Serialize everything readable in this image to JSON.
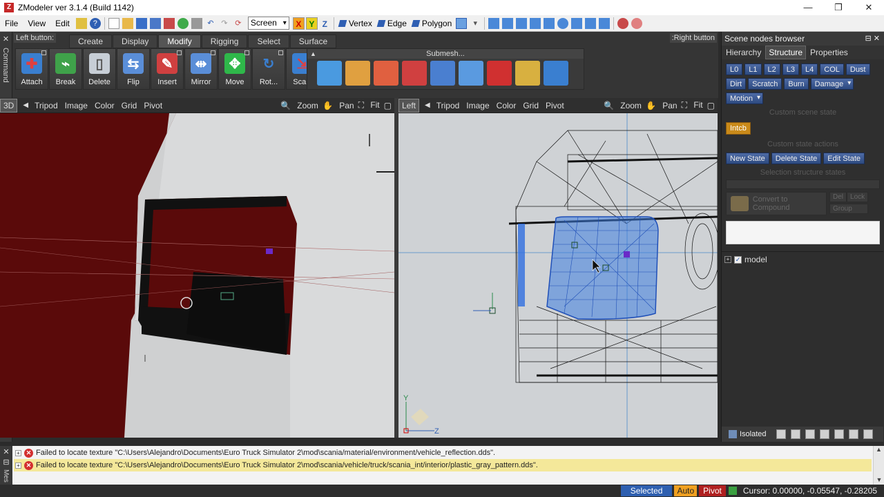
{
  "window": {
    "title": "ZModeler ver 3.1.4 (Build 1142)",
    "app_icon_letter": "Z",
    "controls": {
      "minimize": "—",
      "restore": "❐",
      "close": "✕"
    }
  },
  "menu": {
    "items": [
      "File",
      "View",
      "Edit"
    ],
    "screen_select": "Screen",
    "axes": [
      "X",
      "Y",
      "Z"
    ],
    "modes": [
      "Vertex",
      "Edge",
      "Polygon"
    ]
  },
  "command_strip": {
    "label": "Command",
    "close": "✕"
  },
  "command_panel": {
    "left_button_label": "Left button:",
    "right_button_label": ":Right button",
    "tabs": [
      "Create",
      "Display",
      "Modify",
      "Rigging",
      "Select",
      "Surface"
    ],
    "active_tab": "Modify",
    "tools": [
      {
        "label": "Attach",
        "icon": "attach-icon",
        "color": "#3a7fd0"
      },
      {
        "label": "Break",
        "icon": "break-icon",
        "color": "#3fa24a"
      },
      {
        "label": "Delete",
        "icon": "trash-icon",
        "color": "#c7ced6"
      },
      {
        "label": "Flip",
        "icon": "flip-icon",
        "color": "#5a8ed8"
      },
      {
        "label": "Insert",
        "icon": "insert-icon",
        "color": "#d04040"
      },
      {
        "label": "Mirror",
        "icon": "mirror-icon",
        "color": "#5a8ed8"
      },
      {
        "label": "Move",
        "icon": "move-icon",
        "color": "#2fb84a"
      },
      {
        "label": "Rot...",
        "icon": "rotate-icon",
        "color": "#3a7fd0"
      },
      {
        "label": "Scale",
        "icon": "scale-icon",
        "color": "#3a7fd0"
      }
    ],
    "submesh_title": "Submesh...",
    "submesh_tool_count_icons": [
      "cube-icon",
      "brush-icon",
      "split-icon",
      "split-red-icon",
      "extrude-icon",
      "pen-icon",
      "clip-icon",
      "box-map-icon",
      "uv-map-icon"
    ]
  },
  "viewport_3d": {
    "name": "3D",
    "header_items": [
      "Tripod",
      "Image",
      "Color",
      "Grid",
      "Pivot"
    ],
    "tools": [
      "Zoom",
      "Pan",
      "Fit"
    ]
  },
  "viewport_left": {
    "name": "Left",
    "header_items": [
      "Tripod",
      "Image",
      "Color",
      "Grid",
      "Pivot"
    ],
    "tools": [
      "Zoom",
      "Pan",
      "Fit"
    ],
    "axis_labels": {
      "y": "Y",
      "z": "Z"
    }
  },
  "scene_browser": {
    "title": "Scene nodes browser",
    "tabs": [
      "Hierarchy",
      "Structure",
      "Properties"
    ],
    "active_tab": "Structure",
    "lod_buttons": [
      "L0",
      "L1",
      "L2",
      "L3",
      "L4",
      "COL",
      "Dust"
    ],
    "state_buttons": [
      "Dirt",
      "Scratch",
      "Burn"
    ],
    "damage_dropdown": "Damage",
    "motion_dropdown": "Motion",
    "custom_scene_state_label": "Custom scene state",
    "intcb_label": "Intcb",
    "custom_state_actions_label": "Custom state actions",
    "action_buttons": [
      "New State",
      "Delete State",
      "Edit State"
    ],
    "selection_states_label": "Selection structure states",
    "convert_label": "Convert to Compound",
    "side_buttons": [
      "Del",
      "Lock",
      "Group"
    ],
    "tree": [
      {
        "label": "model",
        "checked": true,
        "expander": "+"
      }
    ],
    "bottom_label": "Isolated"
  },
  "log": {
    "side_label": "Mes",
    "messages": [
      "Failed to locate texture \"C:\\Users\\Alejandro\\Documents\\Euro Truck Simulator 2\\mod\\scania/material/environment/vehicle_reflection.dds\".",
      "Failed to locate texture \"C:\\Users\\Alejandro\\Documents\\Euro Truck Simulator 2\\mod\\scania/vehicle/truck/scania_int/interior/plastic_gray_pattern.dds\"."
    ]
  },
  "statusbar": {
    "selected": "Selected",
    "auto": "Auto",
    "pivot": "Pivot",
    "cursor": "Cursor: 0.00000, -0.05547, -0.28205"
  },
  "colors": {
    "viewport_3d_bg": "#5a0a0a",
    "viewport_left_bg": "#cfd2d5",
    "selection_blue": "#2f6fe0",
    "status_selected": "#2e5fb0",
    "status_auto": "#f0a020",
    "status_pivot": "#b02020",
    "log_highlight": "#f4e89a"
  }
}
